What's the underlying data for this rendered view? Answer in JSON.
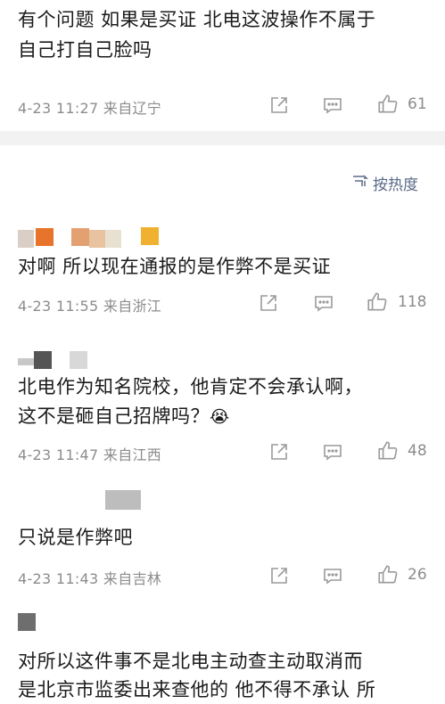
{
  "top_comment": {
    "text_line1": "有个问题 如果是买证 北电这波操作不属于",
    "text_line2": "自己打自己脸吗",
    "meta": "4-23 11:27 来自辽宁",
    "likes": "61"
  },
  "sort": {
    "label": "按热度",
    "icon": "sort-icon"
  },
  "comments": [
    {
      "text_lines": [
        "对啊 所以现在通报的是作弊不是买证"
      ],
      "meta": "4-23 11:55 来自浙江",
      "likes": "118"
    },
    {
      "text_lines": [
        "北电作为知名院校，他肯定不会承认啊，",
        "这不是砸自己招牌吗？"
      ],
      "emoji": "😭",
      "meta": "4-23 11:47 来自江西",
      "likes": "48"
    },
    {
      "text_lines": [
        "只说是作弊吧"
      ],
      "meta": "4-23 11:43 来自吉林",
      "likes": "26"
    },
    {
      "text_lines": [
        "对所以这件事不是北电主动查主动取消而",
        "是北京市监委出来查他的 他不得不承认 所"
      ]
    }
  ],
  "colors": {
    "text": "#1b1b1b",
    "meta": "#8c8c8c",
    "icon": "#9a9a9a",
    "sort": "#5a6a88",
    "band": "#f2f2f2"
  }
}
